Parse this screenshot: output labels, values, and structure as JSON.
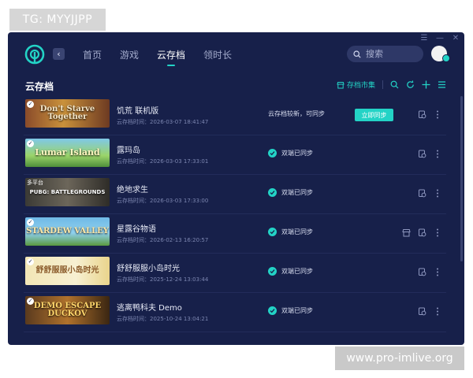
{
  "watermarks": {
    "top": "TG: MYYJJPP",
    "bottom": "www.pro-imlive.org"
  },
  "colors": {
    "background": "#17204a",
    "accent": "#23d3c6",
    "muted": "#7c86b0"
  },
  "nav": {
    "items": [
      "首页",
      "游戏",
      "云存档",
      "领时长"
    ],
    "active": "云存档"
  },
  "search": {
    "placeholder": "搜索"
  },
  "section": {
    "title": "云存档",
    "market_label": "存档市集"
  },
  "rows": [
    {
      "name": "饥荒 联机版",
      "time": "云存档时间：2026-03-07 18:41:47",
      "status": "云存档较新，可同步",
      "action": "立即同步",
      "thumb_text": "Don't Starve Together",
      "has_check": true
    },
    {
      "name": "露玛岛",
      "time": "云存档时间：2026-03-03 17:33:01",
      "status": "双端已同步",
      "thumb_text": "Lumar Island",
      "has_check": true
    },
    {
      "name": "绝地求生",
      "time": "云存档时间：2026-03-03 17:33:00",
      "status": "双端已同步",
      "thumb_text": "PUBG: BATTLEGROUNDS",
      "thumb_tag": "多平台",
      "has_check": false
    },
    {
      "name": "星露谷物语",
      "time": "云存档时间：2026-02-13 16:20:57",
      "status": "双端已同步",
      "thumb_text": "STARDEW VALLEY",
      "has_check": true
    },
    {
      "name": "舒舒服服小岛时光",
      "time": "云存档时间：2025-12-24 13:03:44",
      "status": "双端已同步",
      "thumb_text": "舒舒服服小岛时光",
      "has_check": true
    },
    {
      "name": "逃离鸭科夫 Demo",
      "time": "云存档时间：2025-10-24 13:04:21",
      "status": "双端已同步",
      "thumb_text": "DEMO ESCAPE DUCKOV",
      "has_check": true
    }
  ]
}
